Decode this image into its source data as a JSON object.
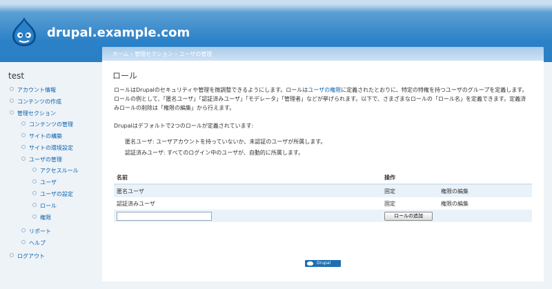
{
  "site": {
    "name": "drupal.example.com",
    "logo_icon": "drupal-drop-logo",
    "colors": {
      "header": "#2b81c7",
      "link": "#0a62aa",
      "row_highlight": "#eaf2f9"
    }
  },
  "sidebar": {
    "user": "test",
    "items": [
      {
        "label": "アカウント情報"
      },
      {
        "label": "コンテンツの作成"
      },
      {
        "label": "管理セクション"
      },
      {
        "label": "コンテンツの管理"
      },
      {
        "label": "サイトの構築"
      },
      {
        "label": "サイトの環境設定"
      },
      {
        "label": "ユーザの管理"
      },
      {
        "label": "アクセスルール"
      },
      {
        "label": "ユーザ"
      },
      {
        "label": "ユーザの設定"
      },
      {
        "label": "ロール"
      },
      {
        "label": "権限"
      },
      {
        "label": "リポート"
      },
      {
        "label": "ヘルプ"
      },
      {
        "label": "ログアウト"
      }
    ]
  },
  "breadcrumb": [
    "ホーム",
    "管理セクション",
    "ユーザの管理"
  ],
  "breadcrumb_separator": "›",
  "page": {
    "title": "ロール",
    "intro_a": "ロールはDrupalのセキュリティや管理を微調整できるようにします。ロールは",
    "intro_link": "ユーザの権限",
    "intro_b": "に定義されたとおりに、特定の特権を持つユーザのグループを定義します。ロールの例として、「匿名ユーザ」「認証済みユーザ」「モデレータ」「管理者」などが挙げられます。以下で、さまざまなロールの「ロール名」を定義できます。定義済みロールの削除は「権限の編集」から行えます。",
    "defaults_intro": "Drupalはデフォルトで2つのロールが定義されています:",
    "anon_desc": "匿名ユーザ: ユーザアカウントを持っていないか、未認証のユーザが所属します。",
    "auth_desc": "認証済みユーザ: すべてのログイン中のユーザが、自動的に所属します。"
  },
  "table": {
    "headers": {
      "name": "名前",
      "ops": "操作"
    },
    "rows": [
      {
        "name": "匿名ユーザ",
        "status": "固定",
        "action": "権限の編集"
      },
      {
        "name": "認証済みユーザ",
        "status": "固定",
        "action": "権限の編集"
      }
    ],
    "new_role": {
      "value": "",
      "placeholder": "",
      "button": "ロールの追加"
    }
  },
  "footer": {
    "powered_by": "Drupal"
  }
}
